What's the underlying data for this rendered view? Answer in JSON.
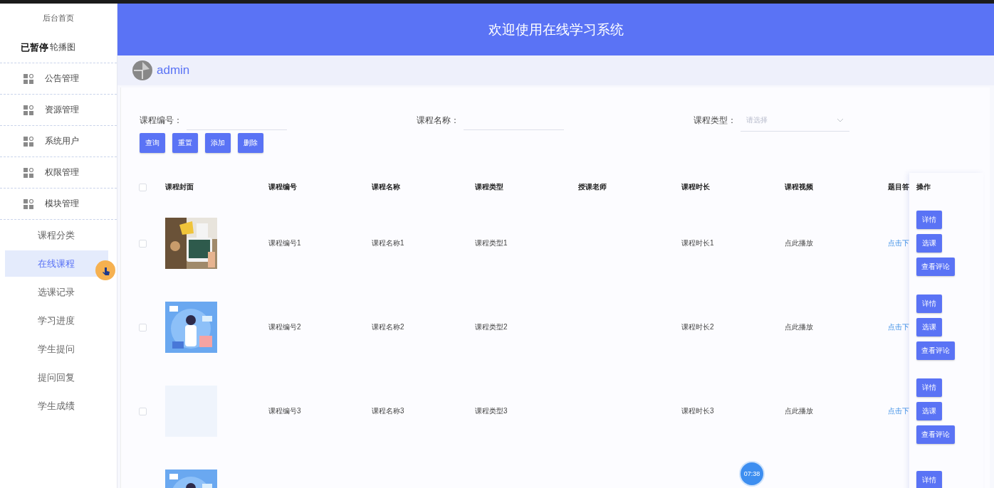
{
  "sidebar": {
    "items": [
      {
        "kind": "top",
        "label": "后台首页",
        "selected": false
      },
      {
        "kind": "group",
        "label": "轮播图",
        "selected": false,
        "overlay": "已暂停"
      },
      {
        "kind": "group",
        "label": "公告管理",
        "selected": false
      },
      {
        "kind": "group",
        "label": "资源管理",
        "selected": false
      },
      {
        "kind": "group",
        "label": "系统用户",
        "selected": false
      },
      {
        "kind": "group",
        "label": "权限管理",
        "selected": false
      },
      {
        "kind": "group",
        "label": "模块管理",
        "selected": false
      },
      {
        "kind": "sub",
        "label": "课程分类",
        "selected": false
      },
      {
        "kind": "sub",
        "label": "在线课程",
        "selected": true
      },
      {
        "kind": "sub",
        "label": "选课记录",
        "selected": false
      },
      {
        "kind": "sub",
        "label": "学习进度",
        "selected": false
      },
      {
        "kind": "sub",
        "label": "学生提问",
        "selected": false
      },
      {
        "kind": "sub",
        "label": "提问回复",
        "selected": false
      },
      {
        "kind": "sub",
        "label": "学生成绩",
        "selected": false
      }
    ]
  },
  "header": {
    "title": "欢迎使用在线学习系统"
  },
  "user": {
    "name": "admin"
  },
  "filters": [
    {
      "kind": "input",
      "label": "课程编号："
    },
    {
      "kind": "input",
      "label": "课程名称："
    },
    {
      "kind": "select",
      "label": "课程类型：",
      "placeholder": "请选择"
    }
  ],
  "buttons": [
    "查询",
    "重置",
    "添加",
    "删除"
  ],
  "table": {
    "columns": [
      "课程封面",
      "课程编号",
      "课程名称",
      "课程类型",
      "授课老师",
      "课程时长",
      "课程视频",
      "题目答",
      "操作"
    ],
    "rows": [
      {
        "checked": false,
        "cover": {
          "kind": "picture"
        },
        "cells": [
          "课程编号1",
          "课程名称1",
          "课程类型1",
          "",
          "课程时长1",
          "点此播放"
        ],
        "link": "点击下",
        "actions": [
          "详情",
          "选课",
          "查看评论"
        ]
      },
      {
        "checked": false,
        "cover": {
          "kind": "picture"
        },
        "cells": [
          "课程编号2",
          "课程名称2",
          "课程类型2",
          "",
          "课程时长2",
          "点此播放"
        ],
        "link": "点击下",
        "actions": [
          "详情",
          "选课",
          "查看评论"
        ]
      },
      {
        "checked": false,
        "cover": {
          "kind": "blank"
        },
        "cells": [
          "课程编号3",
          "课程名称3",
          "课程类型3",
          "",
          "课程时长3",
          "点此播放"
        ],
        "link": "点击下",
        "actions": [
          "详情",
          "选课",
          "查看评论"
        ]
      },
      {
        "cover": {
          "kind": "picture"
        },
        "actions": [
          "详情"
        ]
      }
    ],
    "all_checked": false
  },
  "timer": "07:38"
}
